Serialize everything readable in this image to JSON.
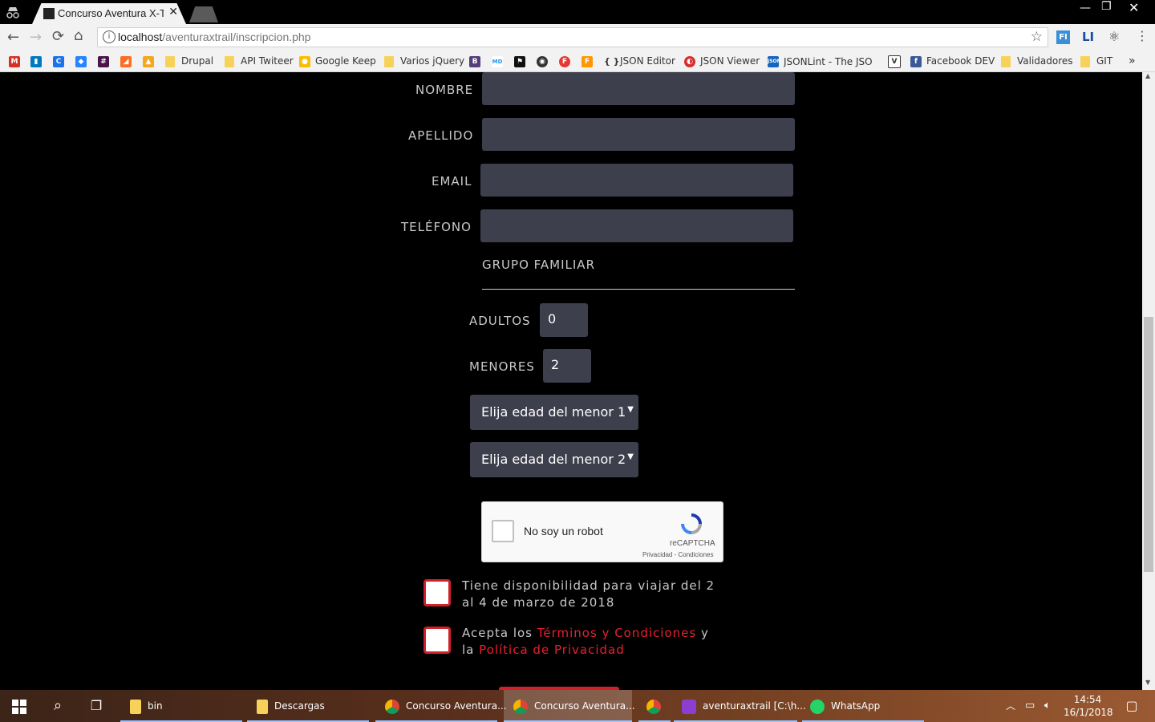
{
  "browser": {
    "tab_title": "Concurso Aventura X-Tra",
    "url_host": "localhost",
    "url_path": "/aventuraxtrail/inscripcion.php",
    "bookmarks": [
      {
        "label": "Drupal"
      },
      {
        "label": "API Twiteer"
      },
      {
        "label": "Google Keep"
      },
      {
        "label": "Varios jQuery"
      },
      {
        "label": "JSON Editor"
      },
      {
        "label": "JSON Viewer"
      },
      {
        "label": "JSONLint - The JSON"
      },
      {
        "label": "Facebook DEV"
      },
      {
        "label": "Validadores"
      },
      {
        "label": "GIT"
      }
    ],
    "more_glyph": "»"
  },
  "form": {
    "nombre_label": "NOMBRE",
    "apellido_label": "APELLIDO",
    "email_label": "EMAIL",
    "telefono_label": "TELÉFONO",
    "grupo_label": "GRUPO FAMILIAR",
    "adultos_label": "ADULTOS",
    "adultos_value": "0",
    "menores_label": "MENORES",
    "menores_value": "2",
    "select1": "Elija edad del menor 1",
    "select2": "Elija edad del menor 2",
    "captcha_label": "No soy un robot",
    "captcha_brand": "reCAPTCHA",
    "captcha_links": "Privacidad - Condiciones",
    "disponibilidad_text": "Tiene disponibilidad para viajar del 2 al 4 de marzo de 2018",
    "acepta_pre": "Acepta los ",
    "terminos_link": "Términos y Condiciones",
    "acepta_mid": " y la ",
    "privacidad_link": "Política de Privacidad",
    "accent_color": "#e8202f"
  },
  "taskbar": {
    "items": [
      {
        "label": "bin"
      },
      {
        "label": "Descargas"
      },
      {
        "label": "Concurso Aventura..."
      },
      {
        "label": "Concurso Aventura..."
      },
      {
        "label": "aventuraxtrail [C:\\h..."
      },
      {
        "label": "WhatsApp"
      }
    ],
    "time": "14:54",
    "date": "16/1/2018"
  }
}
